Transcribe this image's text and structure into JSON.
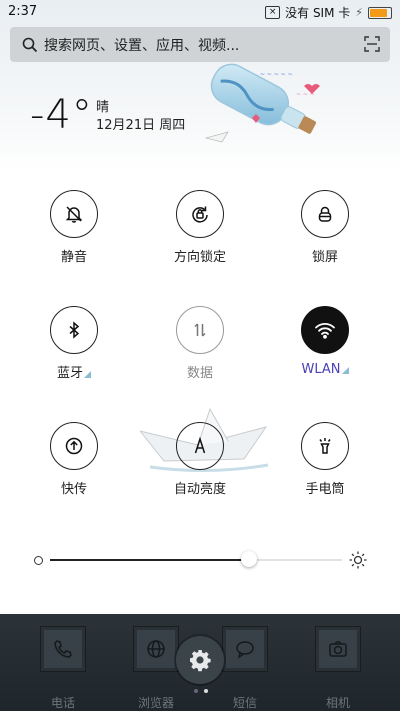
{
  "status_bar": {
    "time": "2:37",
    "sim_text": "没有 SIM 卡",
    "battery_color": "#f39a1a"
  },
  "search": {
    "placeholder": "搜索网页、设置、应用、视频...",
    "icon": "search-icon",
    "scan_icon": "scan-icon"
  },
  "weather": {
    "temperature": "-4°",
    "condition": "晴",
    "date": "12月21日 周四"
  },
  "toggles": [
    {
      "label": "静音",
      "icon": "bell-off-icon",
      "state": "off"
    },
    {
      "label": "方向锁定",
      "icon": "rotation-lock-icon",
      "state": "off"
    },
    {
      "label": "锁屏",
      "icon": "lock-icon",
      "state": "off"
    },
    {
      "label": "蓝牙",
      "icon": "bluetooth-icon",
      "state": "off"
    },
    {
      "label": "数据",
      "icon": "mobile-data-icon",
      "state": "disabled"
    },
    {
      "label": "WLAN",
      "icon": "wifi-icon",
      "state": "on"
    },
    {
      "label": "快传",
      "icon": "quick-transfer-icon",
      "state": "off"
    },
    {
      "label": "自动亮度",
      "icon": "auto-brightness-icon",
      "state": "off"
    },
    {
      "label": "手电筒",
      "icon": "flashlight-icon",
      "state": "off"
    }
  ],
  "brightness": {
    "level": 0.68
  },
  "dock": {
    "apps": [
      {
        "label": "电话",
        "icon": "phone-icon"
      },
      {
        "label": "浏览器",
        "icon": "browser-icon"
      },
      {
        "label": "短信",
        "icon": "message-icon"
      },
      {
        "label": "相机",
        "icon": "camera-icon"
      }
    ],
    "settings_icon": "gear-icon",
    "page_indicator": {
      "pages": 2,
      "current": 2
    }
  },
  "colors": {
    "accent": "#4a3fb6",
    "active_toggle": "#111111"
  }
}
